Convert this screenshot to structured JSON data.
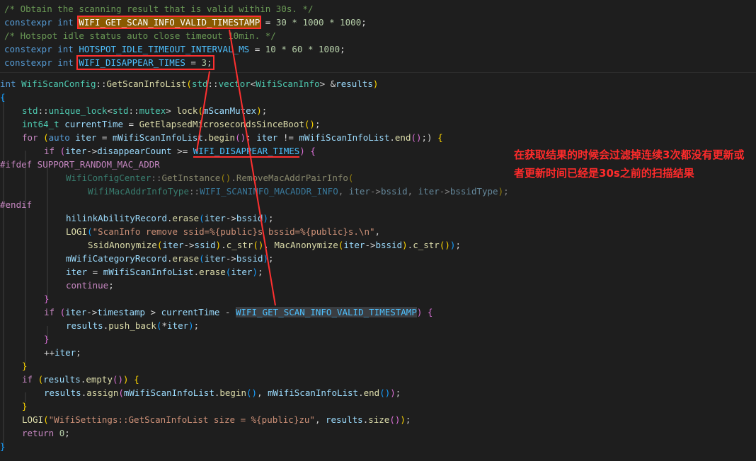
{
  "top": {
    "line1": "/* Obtain the scanning result that is valid within 30s. */",
    "line2_kw": "constexpr int ",
    "line2_name": "WIFI_GET_SCAN_INFO_VALID_TIMESTAMP",
    "line2_eq": " = ",
    "line2_val": "30 * 1000 * 1000",
    "line2_end": ";",
    "line3": "/* Hotspot idle status auto close timeout 10min. */",
    "line4_kw": "constexpr int ",
    "line4_name": "HOTSPOT_IDLE_TIMEOUT_INTERVAL_MS",
    "line4_eq": " = ",
    "line4_val": "10 * 60 * 1000",
    "line4_end": ";",
    "line5_kw": "constexpr int ",
    "line5_name": "WIFI_DISAPPEAR_TIMES",
    "line5_eq": " = ",
    "line5_val": "3",
    "line5_end": ";"
  },
  "code": {
    "l1_int": "int ",
    "l1_cls": "WifiScanConfig",
    "l1_sep": "::",
    "l1_fn": "GetScanInfoList",
    "l1_open": "(",
    "l1_std": "std",
    "l1_vec": "vector",
    "l1_lt": "<",
    "l1_wsi": "WifiScanInfo",
    "l1_gt": "> &",
    "l1_res": "results",
    "l1_close": ")",
    "l2": "{",
    "l3_std": "std",
    "l3_ul": "unique_lock",
    "l3_mutex": "mutex",
    "l3_lock": "lock",
    "l3_arg": "mScanMutex",
    "l4_t": "int64_t",
    "l4_var": "currentTime",
    "l4_fn": "GetElapsedMicrosecondsSinceBoot",
    "l5_for": "for",
    "l5_auto": "auto",
    "l5_iter": "iter",
    "l5_list": "mWifiScanInfoList",
    "l5_begin": "begin",
    "l5_ne": " != ",
    "l5_end": "end",
    "l6_if": "if",
    "l6_iter": "iter",
    "l6_field": "disappearCount",
    "l6_ge": " >= ",
    "l6_const": "WIFI_DISAPPEAR_TIMES",
    "l7": "#ifdef SUPPORT_RANDOM_MAC_ADDR",
    "l8_cls": "WifiConfigCenter",
    "l8_get": "GetInstance",
    "l8_fn": "RemoveMacAddrPairInfo",
    "l9_type": "WifiMacAddrInfoType",
    "l9_const": "WIFI_SCANINFO_MACADDR_INFO",
    "l9_iter1": "iter",
    "l9_bssid": "bssid",
    "l9_iter2": "iter",
    "l9_btype": "bssidType",
    "l10": "#endif",
    "l11_obj": "hilinkAbilityRecord",
    "l11_fn": "erase",
    "l11_iter": "iter",
    "l11_f": "bssid",
    "l12_fn": "LOGI",
    "l12_str": "\"ScanInfo remove ssid=%{public}s bssid=%{public}s.\\n\"",
    "l13_fn1": "SsidAnonymize",
    "l13_iter1": "iter",
    "l13_ssid": "ssid",
    "l13_cstr1": "c_str",
    "l13_fn2": "MacAnonymize",
    "l13_iter2": "iter",
    "l13_bssid": "bssid",
    "l13_cstr2": "c_str",
    "l14_obj": "mWifiCategoryRecord",
    "l14_fn": "erase",
    "l14_iter": "iter",
    "l14_f": "bssid",
    "l15_iter": "iter",
    "l15_list": "mWifiScanInfoList",
    "l15_fn": "erase",
    "l15_arg": "iter",
    "l16": "continue",
    "l17": "}",
    "l18_if": "if",
    "l18_iter": "iter",
    "l18_field": "timestamp",
    "l18_gt": " > ",
    "l18_var": "currentTime",
    "l18_minus": " - ",
    "l18_const": "WIFI_GET_SCAN_INFO_VALID_TIMESTAMP",
    "l19_res": "results",
    "l19_fn": "push_back",
    "l19_iter": "iter",
    "l20": "}",
    "l21_inc": "++",
    "l21_iter": "iter",
    "l22": "}",
    "l23_if": "if",
    "l23_res": "results",
    "l23_fn": "empty",
    "l24_res": "results",
    "l24_fn": "assign",
    "l24_list1": "mWifiScanInfoList",
    "l24_begin": "begin",
    "l24_list2": "mWifiScanInfoList",
    "l24_end": "end",
    "l25": "}",
    "l26_fn": "LOGI",
    "l26_str": "\"WifiSettings::GetScanInfoList size = %{public}zu\"",
    "l26_res": "results",
    "l26_size": "size",
    "l27_ret": "return",
    "l27_val": "0",
    "l28": "}"
  },
  "annotation": {
    "text": "在获取结果的时候会过滤掉连续3次都没有更新或者更新时间已经是30s之前的扫描结果",
    "color": "#ff2b2b"
  },
  "colors": {
    "background": "#1e1e1e",
    "annotation_red": "#ff3030",
    "highlight_orange": "#8a5a00"
  }
}
